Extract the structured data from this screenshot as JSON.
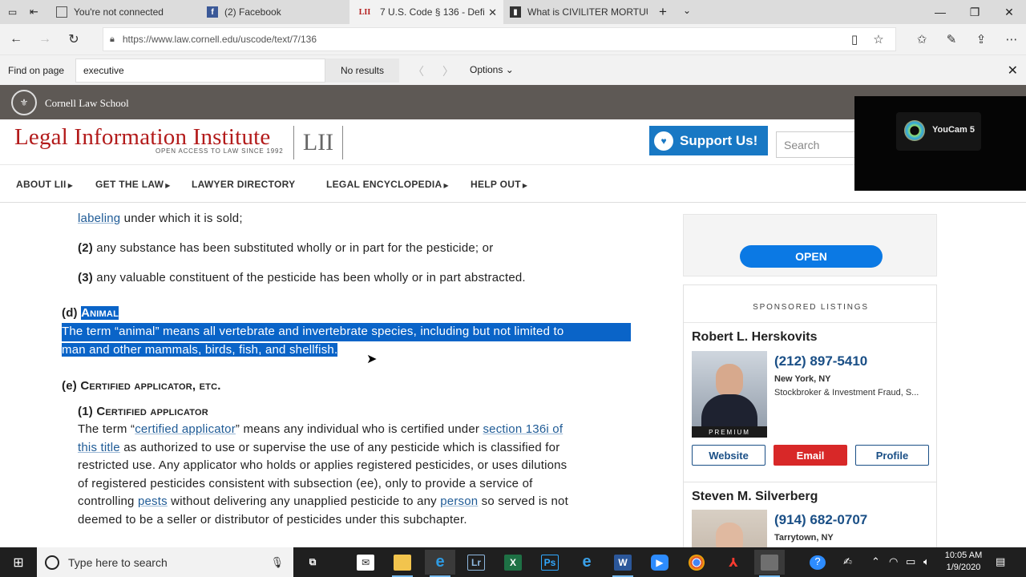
{
  "browser": {
    "tabs": [
      {
        "title": "You're not connected",
        "favicon": "page-icon",
        "active": false
      },
      {
        "title": "(2) Facebook",
        "favicon": "facebook-icon",
        "active": false
      },
      {
        "title": "7 U.S. Code § 136 - Defi",
        "favicon": "lii-icon",
        "favicon_text": "LII",
        "active": true
      },
      {
        "title": "What is CIVILITER MORTUU",
        "favicon": "book-icon",
        "active": false
      }
    ],
    "url": "https://www.law.cornell.edu/uscode/text/7/136"
  },
  "find_bar": {
    "label": "Find on page",
    "query": "executive",
    "results": "No results",
    "options_label": "Options"
  },
  "site": {
    "school": "Cornell Law School",
    "title": "Legal Information Institute",
    "tagline": "OPEN ACCESS TO LAW SINCE 1992",
    "logo_mark": "LII",
    "support_label": "Support Us!",
    "search_placeholder": "Search",
    "nav": [
      "ABOUT LII",
      "GET THE LAW",
      "LAWYER DIRECTORY",
      "LEGAL ENCYCLOPEDIA",
      "HELP OUT"
    ]
  },
  "content": {
    "line0_link": "labeling",
    "line0_rest": " under which it is sold;",
    "item2_num": "(2)",
    "item2_text": " any substance has been substituted wholly or in part for the pesticide; or",
    "item3_num": "(3)",
    "item3_text": " any valuable constituent of the pesticide has been wholly or in part abstracted.",
    "d_num": "(d) ",
    "d_heading": "Animal",
    "d_line1": "The term “animal” means all vertebrate and invertebrate species, including but not limited to",
    "d_line2": "man and other mammals, birds, fish, and shellfish.",
    "e_num": "(e) ",
    "e_heading": "Certified applicator, etc.",
    "e1_num": "(1) ",
    "e1_heading": "Certified applicator",
    "e1_l1_a": "The term “",
    "e1_l1_link1": "certified applicator",
    "e1_l1_b": "” means any individual who is certified under ",
    "e1_l1_link2": "section 136i of",
    "e1_l2_link": "this title",
    "e1_l2_rest": " as authorized to use or supervise the use of any pesticide which is classified for",
    "e1_l3": "restricted use. Any applicator who holds or applies registered pesticides, or uses dilutions",
    "e1_l4": "of registered pesticides consistent with subsection (ee), only to provide a service of",
    "e1_l5_a": "controlling ",
    "e1_l5_link1": "pests",
    "e1_l5_b": " without delivering any unapplied pesticide to any ",
    "e1_l5_link2": "person",
    "e1_l5_c": " so served is not",
    "e1_l6": "deemed to be a seller or distributor of pesticides under this subchapter."
  },
  "sidebar": {
    "open_label": "OPEN",
    "sponsored_title": "SPONSORED LISTINGS",
    "listings": [
      {
        "name": "Robert L. Herskovits",
        "badge": "PREMIUM",
        "phone": "(212) 897-5410",
        "location": "New York, NY",
        "specialty": "Stockbroker & Investment Fraud, S...",
        "website_label": "Website",
        "email_label": "Email",
        "profile_label": "Profile"
      },
      {
        "name": "Steven M. Silverberg",
        "phone": "(914) 682-0707",
        "location": "Tarrytown, NY"
      }
    ]
  },
  "overlay": {
    "app": "YouCam 5"
  },
  "taskbar": {
    "search_placeholder": "Type here to search",
    "apps": [
      "task-view",
      "mail",
      "file-explorer",
      "edge",
      "lightroom",
      "excel",
      "photoshop",
      "internet-explorer",
      "word",
      "zoom",
      "chrome",
      "acrobat",
      "youcam"
    ],
    "time": "10:05 AM",
    "date": "1/9/2020"
  },
  "colors": {
    "lii_red": "#b31b1b",
    "support_blue": "#1878c4",
    "selection_blue": "#0a64c8",
    "email_red": "#d82828",
    "link_blue": "#1f5b96"
  }
}
